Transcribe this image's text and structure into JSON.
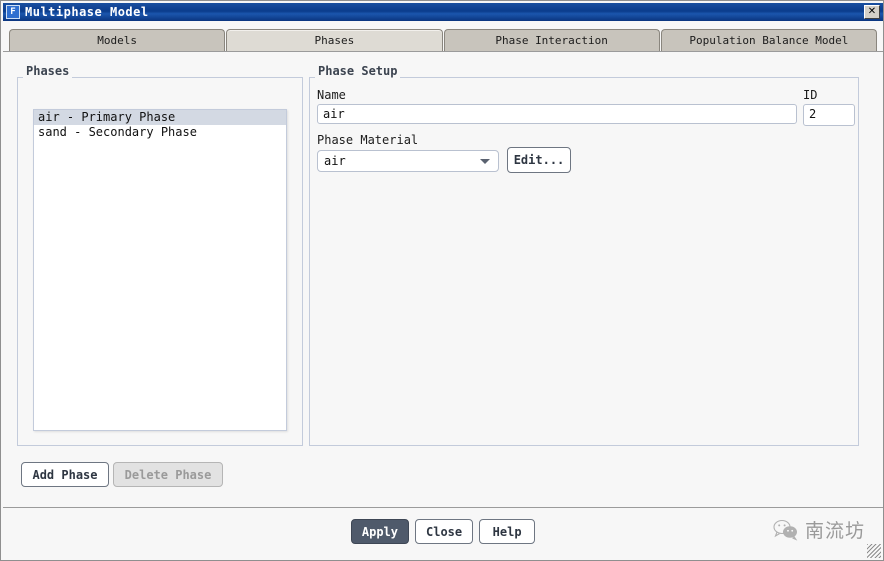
{
  "window": {
    "title": "Multiphase Model",
    "app_icon": "fluent-f-icon",
    "close_label": "✕"
  },
  "tabs": [
    {
      "label": "Models",
      "selected": false
    },
    {
      "label": "Phases",
      "selected": true
    },
    {
      "label": "Phase Interaction",
      "selected": false
    },
    {
      "label": "Population Balance Model",
      "selected": false
    }
  ],
  "phases_panel": {
    "title": "Phases",
    "items": [
      {
        "label": "air - Primary Phase",
        "selected": true
      },
      {
        "label": "sand - Secondary Phase",
        "selected": false
      }
    ],
    "add_button": "Add Phase",
    "delete_button": "Delete Phase"
  },
  "phase_setup": {
    "title": "Phase Setup",
    "name_label": "Name",
    "name_value": "air",
    "id_label": "ID",
    "id_value": "2",
    "material_label": "Phase Material",
    "material_value": "air",
    "edit_button": "Edit..."
  },
  "footer": {
    "apply": "Apply",
    "close": "Close",
    "help": "Help"
  },
  "watermark": {
    "icon": "wechat-icon",
    "text": "南流坊"
  }
}
